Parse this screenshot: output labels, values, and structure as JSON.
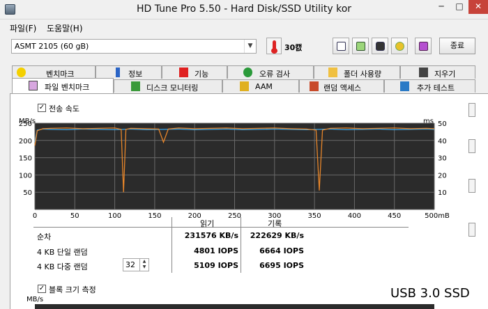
{
  "window": {
    "title": "HD Tune Pro 5.50 - Hard Disk/SSD Utility kor",
    "minimize": "─",
    "maximize": "□",
    "close": "✕"
  },
  "menu": [
    {
      "label": "파일(F)"
    },
    {
      "label": "도움말(H)"
    }
  ],
  "toolbar": {
    "drive": "ASMT    2105 (60 gB)",
    "temperature": "30캜",
    "exit_label": "종료",
    "icons": [
      "copy-info-icon",
      "copy-screen-icon",
      "camera-icon",
      "options-icon",
      "save-download-icon"
    ]
  },
  "tabs_top": [
    {
      "label": "벤치마크",
      "icon": "benchmark-icon"
    },
    {
      "label": "정보",
      "icon": "info-icon"
    },
    {
      "label": "기능",
      "icon": "health-cross-icon"
    },
    {
      "label": "오류 검사",
      "icon": "magnifier-icon"
    },
    {
      "label": "폴더 사용량",
      "icon": "folder-icon"
    },
    {
      "label": "지우기",
      "icon": "trash-icon"
    }
  ],
  "tabs_bottom": [
    {
      "label": "파일 벤치마크",
      "icon": "file-benchmark-icon",
      "active": true
    },
    {
      "label": "디스크 모니터링",
      "icon": "monitor-chart-icon"
    },
    {
      "label": "AAM",
      "icon": "speaker-icon"
    },
    {
      "label": "랜덤 액세스",
      "icon": "random-access-icon"
    },
    {
      "label": "추가 테스트",
      "icon": "extra-tests-icon"
    }
  ],
  "transfer_checkbox": {
    "label": "전송 속도",
    "checked": true
  },
  "block_checkbox": {
    "label": "블록 크기 측정",
    "checked": true
  },
  "chart_data": {
    "type": "line",
    "y_left_unit": "MB/s",
    "y_right_unit": "ms",
    "x_unit": "mB",
    "yleft_ticks": [
      "250",
      "200",
      "150",
      "100",
      "50"
    ],
    "yright_ticks": [
      "50",
      "40",
      "30",
      "20",
      "10"
    ],
    "x_ticks": [
      "0",
      "50",
      "100",
      "150",
      "200",
      "250",
      "300",
      "350",
      "400",
      "450",
      "500mB"
    ],
    "xlim": [
      0,
      500
    ],
    "ylim_left": [
      0,
      250
    ],
    "ylim_right": [
      0,
      50
    ],
    "grid": true,
    "series": [
      {
        "color": "#3fa7e8",
        "x": [
          0,
          3,
          10,
          20,
          40,
          60,
          80,
          100,
          110,
          120,
          140,
          160,
          180,
          200,
          220,
          240,
          260,
          280,
          300,
          320,
          340,
          355,
          370,
          390,
          410,
          430,
          450,
          470,
          490,
          500
        ],
        "y": [
          195,
          230,
          233,
          232,
          231,
          233,
          232,
          231,
          232,
          233,
          231,
          232,
          233,
          231,
          232,
          233,
          231,
          232,
          233,
          232,
          231,
          232,
          233,
          231,
          232,
          233,
          231,
          232,
          233,
          232
        ]
      },
      {
        "color": "#e8862a",
        "x": [
          0,
          3,
          10,
          20,
          40,
          60,
          80,
          100,
          108,
          111,
          114,
          120,
          140,
          155,
          161,
          167,
          180,
          200,
          220,
          240,
          260,
          280,
          300,
          320,
          340,
          352,
          356,
          360,
          370,
          390,
          410,
          430,
          450,
          470,
          490,
          500
        ],
        "y": [
          185,
          228,
          234,
          235,
          236,
          234,
          235,
          236,
          232,
          50,
          232,
          235,
          234,
          233,
          195,
          233,
          236,
          234,
          235,
          236,
          234,
          235,
          236,
          234,
          233,
          230,
          55,
          230,
          235,
          236,
          234,
          235,
          236,
          234,
          235,
          234
        ]
      }
    ]
  },
  "results": {
    "col_read": "읽기",
    "col_write": "기록",
    "rows": [
      {
        "label": "순차",
        "read": "231576 KB/s",
        "write": "222629 KB/s"
      },
      {
        "label": "4 KB 단일 랜덤",
        "read": "4801 IOPS",
        "write": "6664 IOPS"
      },
      {
        "label": "4 KB 다중 랜덤",
        "read": "5109 IOPS",
        "write": "6695 IOPS"
      }
    ],
    "queue_depth": "32"
  },
  "block_chart_unit": "MB/s",
  "watermark": "USB 3.0 SSD"
}
